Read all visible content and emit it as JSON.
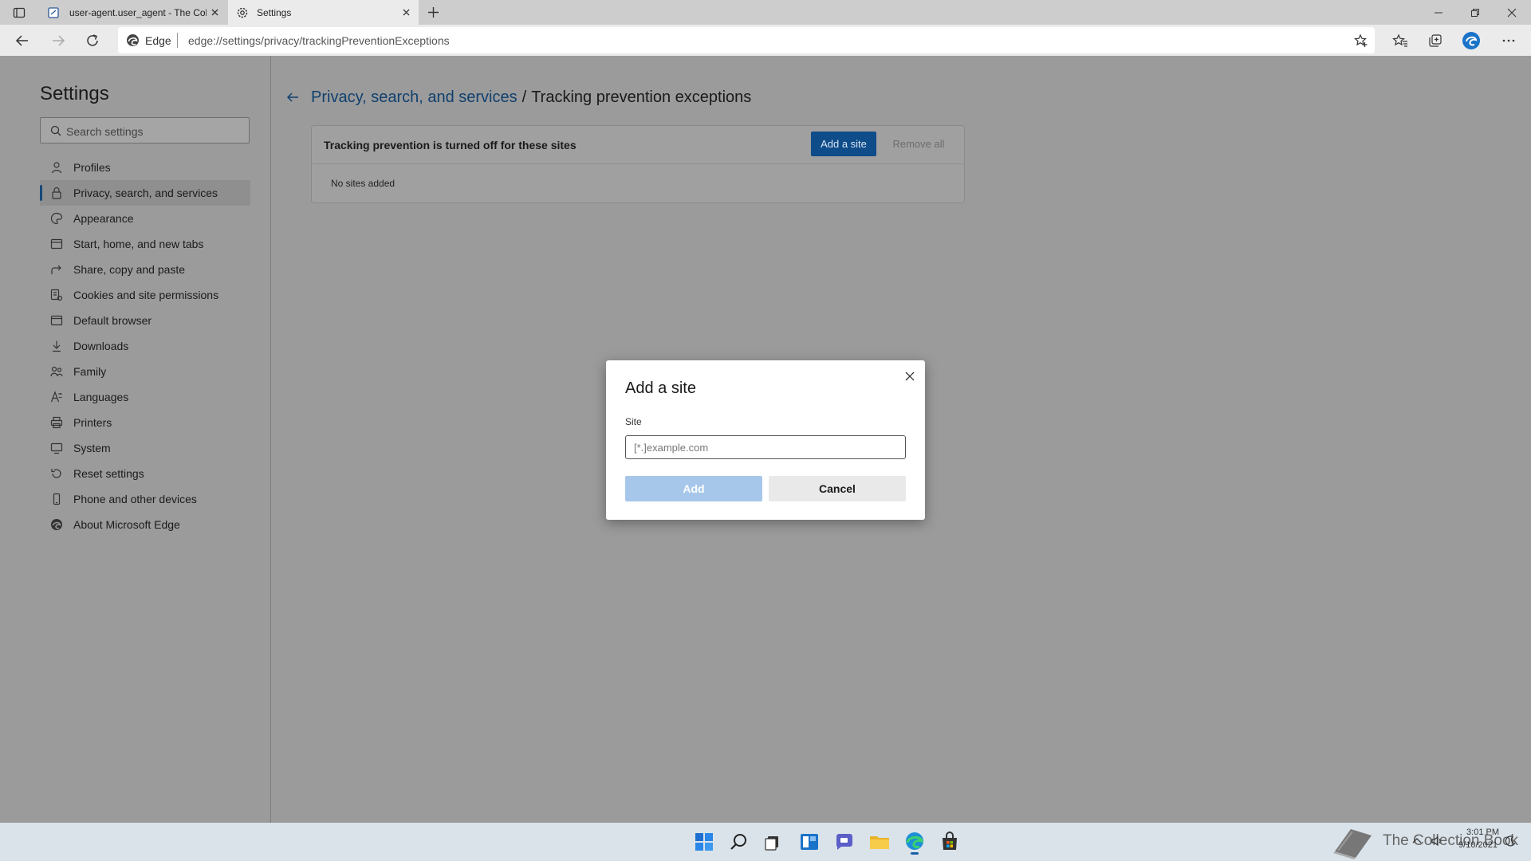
{
  "tabs": [
    {
      "title": "user-agent.user_agent - The Coll"
    },
    {
      "title": "Settings"
    }
  ],
  "address": {
    "scheme_label": "Edge",
    "url": "edge://settings/privacy/trackingPreventionExceptions"
  },
  "sidebar": {
    "title": "Settings",
    "search_placeholder": "Search settings",
    "items": [
      {
        "label": "Profiles"
      },
      {
        "label": "Privacy, search, and services"
      },
      {
        "label": "Appearance"
      },
      {
        "label": "Start, home, and new tabs"
      },
      {
        "label": "Share, copy and paste"
      },
      {
        "label": "Cookies and site permissions"
      },
      {
        "label": "Default browser"
      },
      {
        "label": "Downloads"
      },
      {
        "label": "Family"
      },
      {
        "label": "Languages"
      },
      {
        "label": "Printers"
      },
      {
        "label": "System"
      },
      {
        "label": "Reset settings"
      },
      {
        "label": "Phone and other devices"
      },
      {
        "label": "About Microsoft Edge"
      }
    ]
  },
  "breadcrumb": {
    "parent": "Privacy, search, and services",
    "separator": "/",
    "current": "Tracking prevention exceptions"
  },
  "card": {
    "heading": "Tracking prevention is turned off for these sites",
    "add_button": "Add a site",
    "remove_button": "Remove all",
    "empty_text": "No sites added"
  },
  "dialog": {
    "title": "Add a site",
    "field_label": "Site",
    "placeholder": "[*.]example.com",
    "value": "",
    "add_button": "Add",
    "cancel_button": "Cancel"
  },
  "taskbar": {
    "time": "3:01 PM",
    "date": "9/10/2021",
    "watermark": "The Collection Book"
  },
  "colors": {
    "accent": "#0f4c8a",
    "link": "#10406e",
    "overlay_bg": "#9b9b9b",
    "add_disabled": "#a7c7ea"
  }
}
